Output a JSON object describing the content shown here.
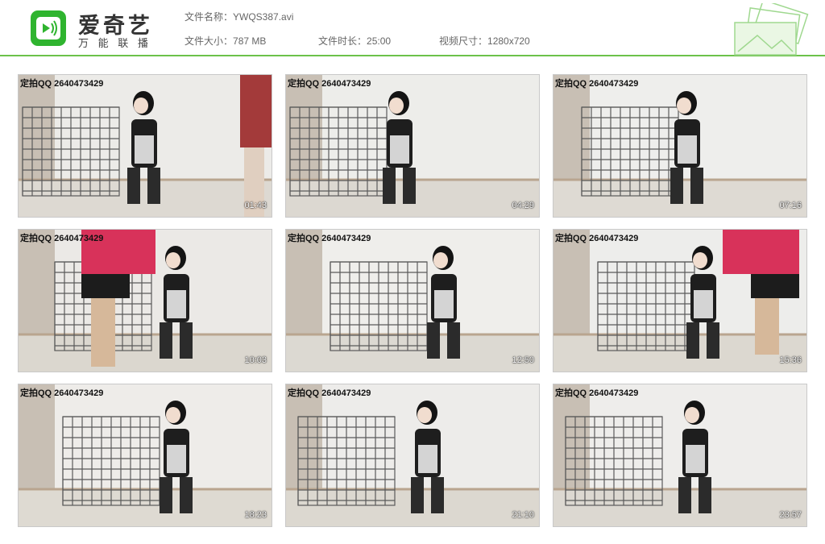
{
  "brand": {
    "name": "爱奇艺",
    "tagline": "万 能 联 播",
    "accent": "#2fb42f"
  },
  "file": {
    "name_label": "文件名称：",
    "name": "YWQS387.avi",
    "size_label": "文件大小：",
    "size": "787 MB",
    "duration_label": "文件时长：",
    "duration": "25:00",
    "dims_label": "视频尺寸：",
    "dims": "1280x720"
  },
  "thumbnails": [
    {
      "watermark": "定拍QQ 2640473429",
      "timestamp": "01:43"
    },
    {
      "watermark": "定拍QQ 2640473429",
      "timestamp": "04:29"
    },
    {
      "watermark": "定拍QQ 2640473429",
      "timestamp": "07:16"
    },
    {
      "watermark": "定拍QQ 2640473429",
      "timestamp": "10:03"
    },
    {
      "watermark": "定拍QQ 2640473429",
      "timestamp": "12:50"
    },
    {
      "watermark": "定拍QQ 2640473429",
      "timestamp": "15:36"
    },
    {
      "watermark": "定拍QQ 2640473429",
      "timestamp": "18:23"
    },
    {
      "watermark": "定拍QQ 2640473429",
      "timestamp": "21:10"
    },
    {
      "watermark": "定拍QQ 2640473429",
      "timestamp": "23:57"
    }
  ]
}
